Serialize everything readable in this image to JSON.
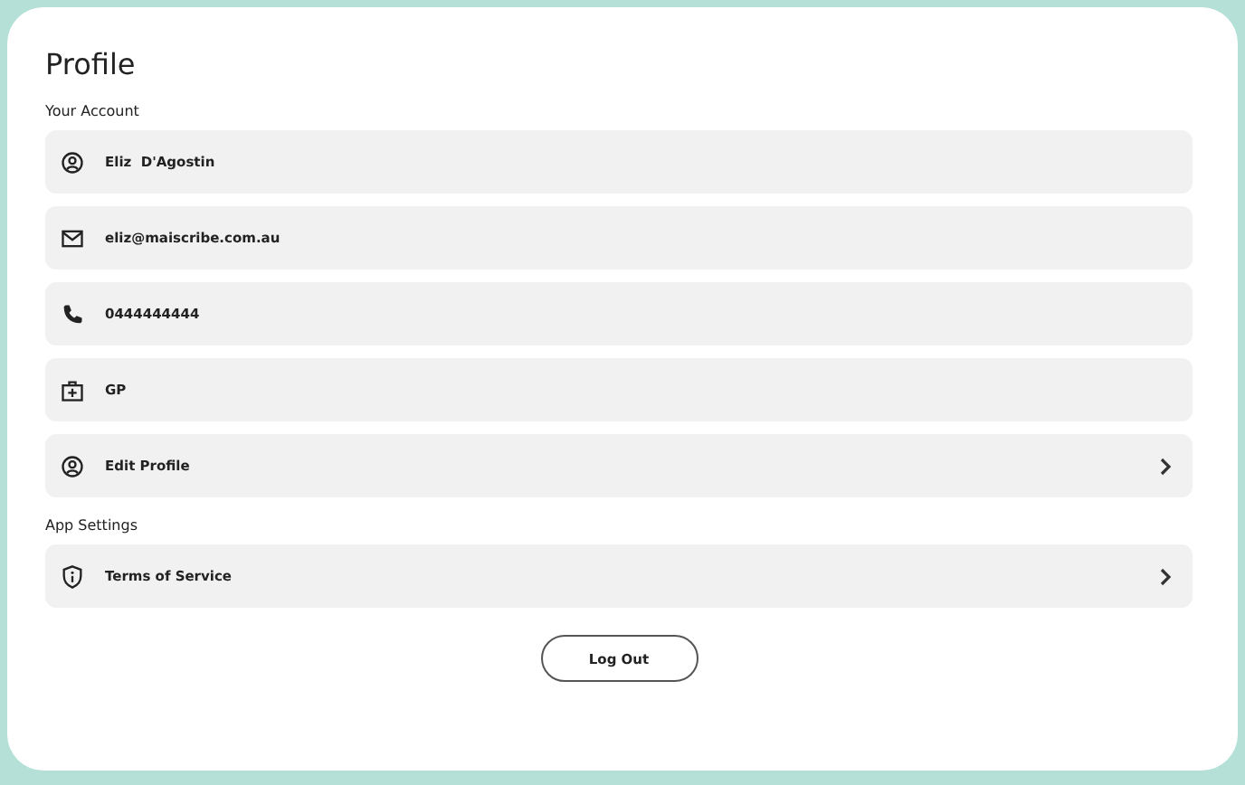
{
  "title": "Profile",
  "sections": [
    {
      "label": "Your Account",
      "rows": [
        {
          "kind": "person",
          "label": "Eliz  D'Agostin",
          "chevron": false
        },
        {
          "kind": "mail",
          "label": "eliz@maiscribe.com.au",
          "chevron": false
        },
        {
          "kind": "phone",
          "label": "0444444444",
          "chevron": false
        },
        {
          "kind": "medical",
          "label": "GP",
          "chevron": false
        },
        {
          "kind": "person",
          "label": "Edit Profile",
          "chevron": true
        }
      ]
    },
    {
      "label": "App Settings",
      "rows": [
        {
          "kind": "shield",
          "label": "Terms of Service",
          "chevron": true
        }
      ]
    }
  ],
  "button": "Log Out"
}
